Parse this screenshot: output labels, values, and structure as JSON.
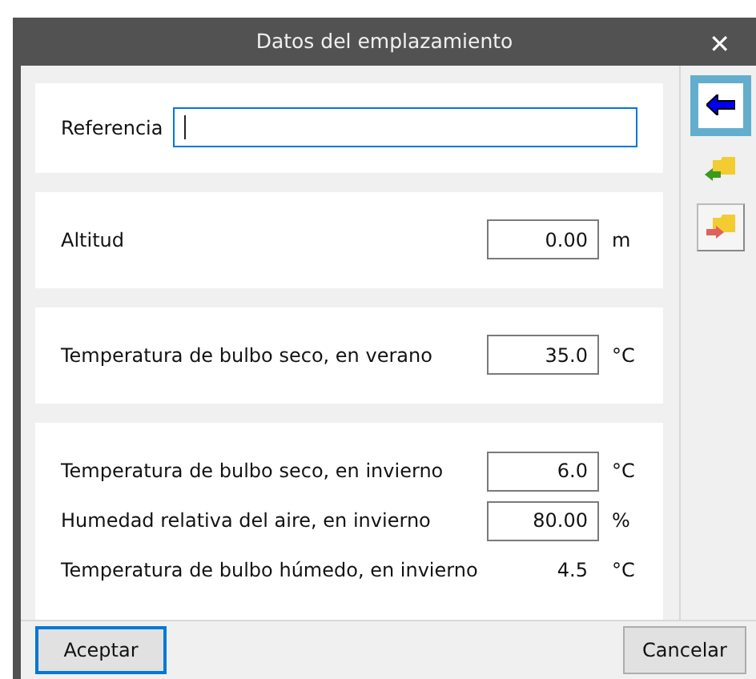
{
  "window": {
    "title": "Datos del emplazamiento",
    "close": "✕"
  },
  "sections": [
    {
      "rows": [
        {
          "kind": "text",
          "label": "Referencia",
          "value": ""
        }
      ]
    },
    {
      "rows": [
        {
          "kind": "number",
          "label": "Altitud",
          "value": "0.00",
          "unit": "m"
        }
      ]
    },
    {
      "rows": [
        {
          "kind": "number",
          "label": "Temperatura de bulbo seco, en verano",
          "value": "35.0",
          "unit": "°C"
        }
      ]
    },
    {
      "rows": [
        {
          "kind": "number",
          "label": "Temperatura de bulbo seco, en invierno",
          "value": "6.0",
          "unit": "°C"
        },
        {
          "kind": "number",
          "label": "Humedad relativa del aire, en invierno",
          "value": "80.00",
          "unit": "%"
        },
        {
          "kind": "readout",
          "label": "Temperatura de bulbo húmedo, en invierno",
          "value": "4.5",
          "unit": "°C"
        }
      ]
    }
  ],
  "tools": [
    {
      "kind": "back",
      "selected": true
    },
    {
      "kind": "import",
      "selected": false
    },
    {
      "kind": "export",
      "selected": false
    }
  ],
  "buttons": [
    {
      "label": "Aceptar",
      "default": true
    },
    {
      "label": "Cancelar",
      "default": false
    }
  ]
}
